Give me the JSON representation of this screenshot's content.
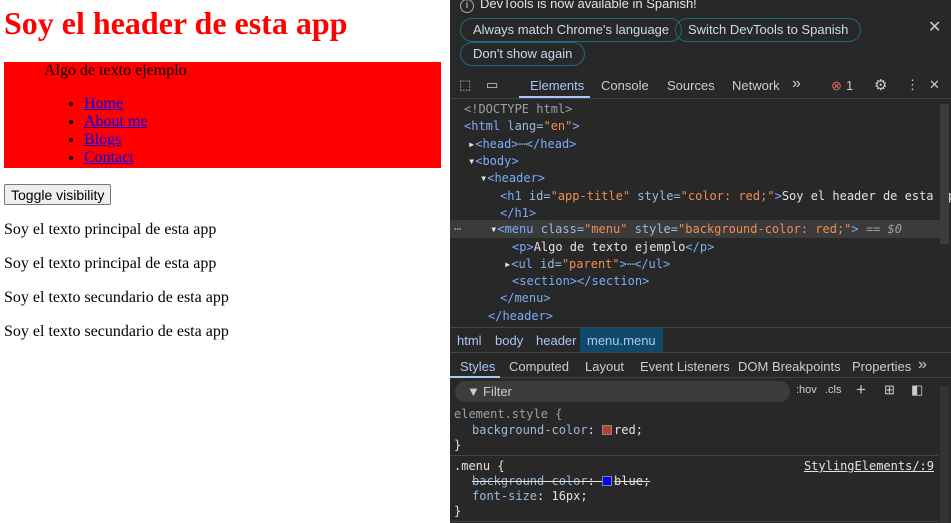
{
  "page": {
    "title": "Soy el header de esta app",
    "menu_text": "Algo de texto ejemplo",
    "links": [
      "Home",
      "About me",
      "Blogs",
      "Contact"
    ],
    "toggle_label": "Toggle visibility",
    "paragraphs": [
      "Soy el texto principal de esta app",
      "Soy el texto principal de esta app",
      "Soy el texto secundario de esta app",
      "Soy el texto secundario de esta app"
    ]
  },
  "devtools": {
    "info": {
      "message": "DevTools is now available in Spanish!",
      "btn_match": "Always match Chrome's language",
      "btn_switch": "Switch DevTools to Spanish",
      "btn_dont": "Don't show again"
    },
    "tabs": [
      "Elements",
      "Console",
      "Sources",
      "Network"
    ],
    "more": "»",
    "error_count": "1",
    "tree": {
      "doctype": "<!DOCTYPE html>",
      "html_open": "<html ",
      "lang_attr": "lang=",
      "lang_val": "\"en\"",
      "close": ">",
      "head": "<head>",
      "head_close": "</head>",
      "body": "<body>",
      "header": "<header>",
      "h1_open": "<h1 ",
      "h1_id": "id=",
      "h1_id_val": "\"app-title\"",
      "style_attr": " style=",
      "h1_style_val": "\"color: red;\"",
      "h1_text": "Soy el header de esta app",
      "h1_close": "</h1>",
      "menu_open": "<menu ",
      "class_attr": "class=",
      "class_val": "\"menu\"",
      "menu_style_val": "\"background-color: red;\"",
      "eq": " == $0",
      "p_open": "<p>",
      "p_text": "Algo de texto ejemplo",
      "p_close": "</p>",
      "ul_open": "<ul ",
      "ul_id": "id=",
      "ul_id_val": "\"parent\"",
      "ul_close": "</ul>",
      "section": "<section></section>",
      "menu_close": "</menu>",
      "header_close": "</header>"
    },
    "breadcrumbs": [
      "html",
      "body",
      "header",
      "menu.menu"
    ],
    "style_tabs": [
      "Styles",
      "Computed",
      "Layout",
      "Event Listeners",
      "DOM Breakpoints",
      "Properties"
    ],
    "filter_placeholder": "Filter",
    "hov": ":hov",
    "cls": ".cls",
    "rules": {
      "el_selector": "element.style {",
      "el_prop": "background-color",
      "el_val": "red;",
      "close_brace": "}",
      "menu_selector": ".menu {",
      "menu_source": "StylingElements/:9",
      "menu_prop1": "background-color",
      "menu_val1": "blue;",
      "menu_prop2": "font-size",
      "menu_val2": "16px;"
    },
    "colors": {
      "red": "#ff0000",
      "blue": "#0000ff",
      "accent": "#a8c7fa"
    }
  }
}
